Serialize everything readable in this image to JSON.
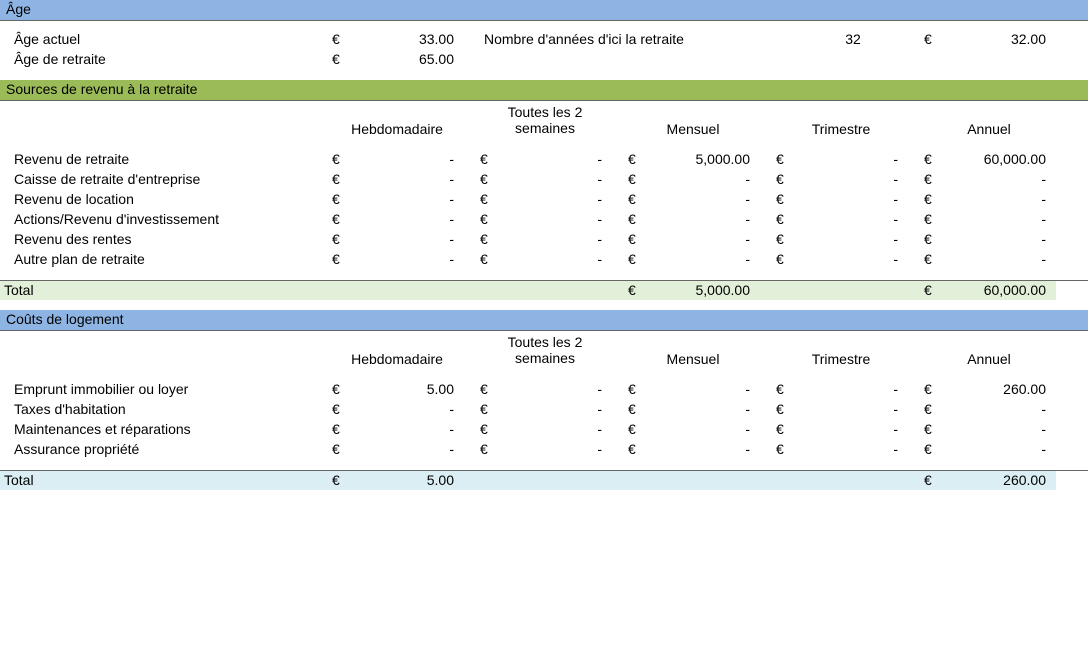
{
  "currency": "€",
  "dash": "-",
  "age_section": {
    "title": "Âge",
    "row1_label": "Âge actuel",
    "row1_val": "33.00",
    "row1_extra_label": "Nombre d'années d'ici la retraite",
    "row1_extra_mid": "32",
    "row1_extra_val": "32.00",
    "row2_label": "Âge de retraite",
    "row2_val": "65.00"
  },
  "cols": {
    "c1": "Hebdomadaire",
    "c2": "Toutes les 2 semaines",
    "c3": "Mensuel",
    "c4": "Trimestre",
    "c5": "Annuel"
  },
  "income": {
    "title": "Sources de revenu à la retraite",
    "rows": [
      {
        "label": "Revenu de retraite",
        "v": [
          "-",
          "-",
          "5,000.00",
          "-",
          "60,000.00"
        ]
      },
      {
        "label": "Caisse de retraite d'entreprise",
        "v": [
          "-",
          "-",
          "-",
          "-",
          "-"
        ]
      },
      {
        "label": "Revenu de location",
        "v": [
          "-",
          "-",
          "-",
          "-",
          "-"
        ]
      },
      {
        "label": "Actions/Revenu d'investissement",
        "v": [
          "-",
          "-",
          "-",
          "-",
          "-"
        ]
      },
      {
        "label": "Revenu des rentes",
        "v": [
          "-",
          "-",
          "-",
          "-",
          "-"
        ]
      },
      {
        "label": "Autre plan de retraite",
        "v": [
          "-",
          "-",
          "-",
          "-",
          "-"
        ]
      }
    ],
    "total_label": "Total",
    "total": [
      "",
      "",
      "5,000.00",
      "",
      "60,000.00"
    ],
    "total_cur": [
      "",
      "",
      "€",
      "",
      "€"
    ]
  },
  "housing": {
    "title": "Coûts de logement",
    "rows": [
      {
        "label": "Emprunt immobilier ou loyer",
        "v": [
          "5.00",
          "-",
          "-",
          "-",
          "260.00"
        ]
      },
      {
        "label": "Taxes d'habitation",
        "v": [
          "-",
          "-",
          "-",
          "-",
          "-"
        ]
      },
      {
        "label": "Maintenances et réparations",
        "v": [
          "-",
          "-",
          "-",
          "-",
          "-"
        ]
      },
      {
        "label": "Assurance propriété",
        "v": [
          "-",
          "-",
          "-",
          "-",
          "-"
        ]
      }
    ],
    "total_label": "Total",
    "total": [
      "5.00",
      "",
      "",
      "",
      "260.00"
    ],
    "total_cur": [
      "€",
      "",
      "",
      "",
      "€"
    ]
  }
}
